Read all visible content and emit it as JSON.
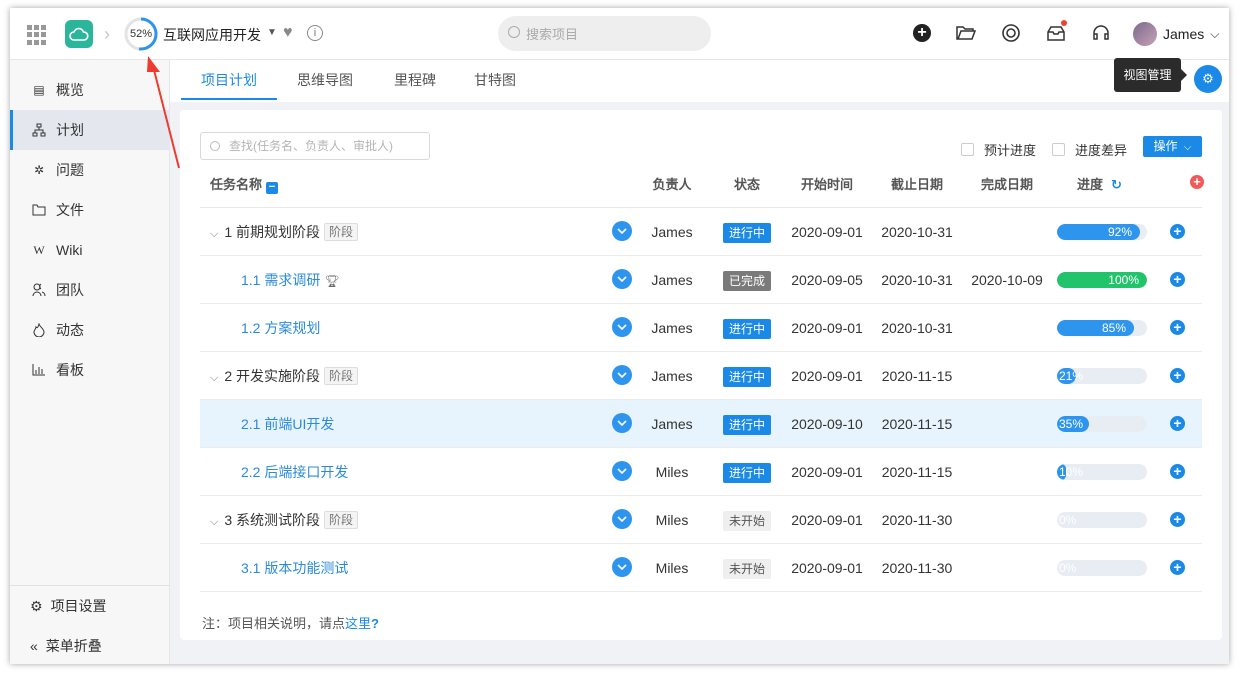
{
  "header": {
    "project_progress": "52%",
    "project_progress_value": 0.52,
    "project_title": "互联网应用开发",
    "search_placeholder": "搜索项目",
    "user_name": "James",
    "colors": {
      "accent": "#1a8ae6",
      "logo": "#2bb59a",
      "notification_dot": "#f04134"
    },
    "icons": [
      "apps-grid-icon",
      "cloud-logo-icon",
      "chevron-right-icon",
      "heart-icon",
      "info-icon",
      "search-icon",
      "plus-circle-icon",
      "folder-open-icon",
      "lifebuoy-icon",
      "inbox-icon",
      "headset-icon",
      "chevron-down-icon"
    ]
  },
  "sidebar": {
    "items": [
      {
        "label": "概览",
        "icon": "document-icon"
      },
      {
        "label": "计划",
        "icon": "sitemap-icon",
        "active": true
      },
      {
        "label": "问题",
        "icon": "bug-icon"
      },
      {
        "label": "文件",
        "icon": "folder-icon"
      },
      {
        "label": "Wiki",
        "icon": "wiki-icon"
      },
      {
        "label": "团队",
        "icon": "team-icon"
      },
      {
        "label": "动态",
        "icon": "flame-icon"
      },
      {
        "label": "看板",
        "icon": "bar-chart-icon"
      }
    ],
    "footer": [
      {
        "label": "项目设置",
        "icon": "gear-icon"
      },
      {
        "label": "菜单折叠",
        "icon": "double-chevron-left-icon"
      }
    ]
  },
  "tabs": [
    {
      "label": "项目计划",
      "active": true
    },
    {
      "label": "思维导图"
    },
    {
      "label": "里程碑"
    },
    {
      "label": "甘特图"
    }
  ],
  "tooltip": "视图管理",
  "toolbar": {
    "filter_placeholder": "查找(任务名、负责人、审批人)",
    "check_planned": "预计进度",
    "check_diff": "进度差异",
    "ops_label": "操作"
  },
  "table": {
    "columns": [
      "任务名称",
      "负责人",
      "状态",
      "开始时间",
      "截止日期",
      "完成日期",
      "进度"
    ],
    "stage_tag": "阶段",
    "rows": [
      {
        "name": "1 前期规划阶段",
        "stage": true,
        "owner": "James",
        "status": "进行中",
        "status_type": "progress",
        "start": "2020-09-01",
        "due": "2020-10-31",
        "done": "",
        "progress": 92,
        "progress_label": "92%"
      },
      {
        "name": "1.1 需求调研",
        "stage": false,
        "trophy": true,
        "owner": "James",
        "status": "已完成",
        "status_type": "done",
        "start": "2020-09-05",
        "due": "2020-10-31",
        "done": "2020-10-09",
        "progress": 100,
        "progress_label": "100%"
      },
      {
        "name": "1.2 方案规划",
        "stage": false,
        "owner": "James",
        "status": "进行中",
        "status_type": "progress",
        "start": "2020-09-01",
        "due": "2020-10-31",
        "done": "",
        "progress": 85,
        "progress_label": "85%"
      },
      {
        "name": "2 开发实施阶段",
        "stage": true,
        "owner": "James",
        "status": "进行中",
        "status_type": "progress",
        "start": "2020-09-01",
        "due": "2020-11-15",
        "done": "",
        "progress": 21,
        "progress_label": "21%"
      },
      {
        "name": "2.1 前端UI开发",
        "stage": false,
        "highlight": true,
        "owner": "James",
        "status": "进行中",
        "status_type": "progress",
        "start": "2020-09-10",
        "due": "2020-11-15",
        "done": "",
        "progress": 35,
        "progress_label": "35%"
      },
      {
        "name": "2.2 后端接口开发",
        "stage": false,
        "owner": "Miles",
        "status": "进行中",
        "status_type": "progress",
        "start": "2020-09-01",
        "due": "2020-11-15",
        "done": "",
        "progress": 10,
        "progress_label": "10%"
      },
      {
        "name": "3 系统测试阶段",
        "stage": true,
        "owner": "Miles",
        "status": "未开始",
        "status_type": "todo",
        "start": "2020-09-01",
        "due": "2020-11-30",
        "done": "",
        "progress": 0,
        "progress_label": "0%"
      },
      {
        "name": "3.1 版本功能测试",
        "stage": false,
        "owner": "Miles",
        "status": "未开始",
        "status_type": "todo",
        "start": "2020-09-01",
        "due": "2020-11-30",
        "done": "",
        "progress": 0,
        "progress_label": "0%"
      }
    ],
    "status_colors": {
      "progress": "#1a8ae6",
      "done": "#7a7a7a",
      "todo": "#efefef"
    },
    "progress_colors": {
      "normal": "#2e95ee",
      "complete": "#21c36b",
      "track": "#e8ecf3"
    }
  },
  "note": {
    "prefix": "注：项目相关说明，请点",
    "link": "这里",
    "suffix": "?"
  }
}
